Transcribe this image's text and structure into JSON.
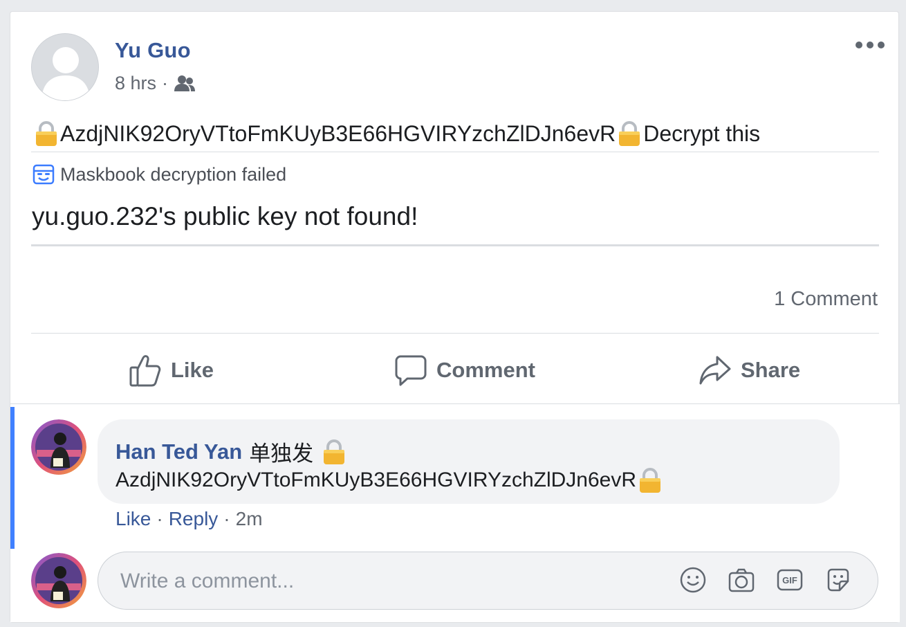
{
  "post": {
    "author": "Yu Guo",
    "time": "8 hrs",
    "meta_separator": "·",
    "audience_icon": "friends-icon",
    "encrypted_text": "AzdjNIK92OryVTtoFmKUyB3E66HGVIRYzchZlDJn6evR",
    "after_text": "Decrypt this",
    "more_icon": "ellipsis-icon"
  },
  "maskbook": {
    "status": "Maskbook decryption failed",
    "error": "yu.guo.232's public key not found!"
  },
  "footer": {
    "comment_count": "1 Comment",
    "like_label": "Like",
    "comment_label": "Comment",
    "share_label": "Share"
  },
  "comment": {
    "author": "Han Ted Yan",
    "prefix": "单独发",
    "encrypted_text": "AzdjNIK92OryVTtoFmKUyB3E66HGVIRYzchZlDJn6evR",
    "like": "Like",
    "reply": "Reply",
    "separator": "·",
    "time": "2m"
  },
  "composer": {
    "placeholder": "Write a comment...",
    "icons": [
      "emoji-icon",
      "camera-icon",
      "gif-icon",
      "sticker-icon"
    ]
  },
  "colors": {
    "link": "#385898",
    "accent": "#4080ff",
    "muted": "#616770"
  }
}
